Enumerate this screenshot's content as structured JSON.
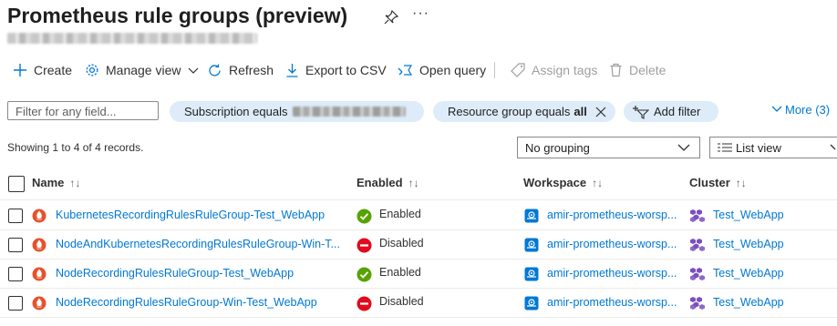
{
  "header": {
    "title": "Prometheus rule groups (preview)",
    "more_glyph": "···"
  },
  "toolbar": {
    "create": "Create",
    "manage_view": "Manage view",
    "refresh": "Refresh",
    "export_csv": "Export to CSV",
    "open_query": "Open query",
    "assign_tags": "Assign tags",
    "delete": "Delete"
  },
  "filters": {
    "search_placeholder": "Filter for any field...",
    "subscription_label": "Subscription equals",
    "resource_group_label": "Resource group equals",
    "resource_group_value": "all",
    "add_filter": "Add filter",
    "more": "More (3)"
  },
  "list": {
    "showing": "Showing 1 to 4 of 4 records.",
    "grouping": "No grouping",
    "view": "List view",
    "columns": {
      "name": "Name",
      "enabled": "Enabled",
      "workspace": "Workspace",
      "cluster": "Cluster"
    },
    "rows": [
      {
        "name": "KubernetesRecordingRulesRuleGroup-Test_WebApp",
        "enabled": "Enabled",
        "workspace": "amir-prometheus-worsp...",
        "cluster": "Test_WebApp"
      },
      {
        "name": "NodeAndKubernetesRecordingRulesRuleGroup-Win-T...",
        "enabled": "Disabled",
        "workspace": "amir-prometheus-worsp...",
        "cluster": "Test_WebApp"
      },
      {
        "name": "NodeRecordingRulesRuleGroup-Test_WebApp",
        "enabled": "Enabled",
        "workspace": "amir-prometheus-worsp...",
        "cluster": "Test_WebApp"
      },
      {
        "name": "NodeRecordingRulesRuleGroup-Win-Test_WebApp",
        "enabled": "Disabled",
        "workspace": "amir-prometheus-worsp...",
        "cluster": "Test_WebApp"
      }
    ]
  },
  "colors": {
    "accent": "#0078d4",
    "enabled": "#57a300",
    "disabled": "#e00b1c",
    "prometheus": "#e6522c",
    "aks": "#7b4fc0"
  }
}
